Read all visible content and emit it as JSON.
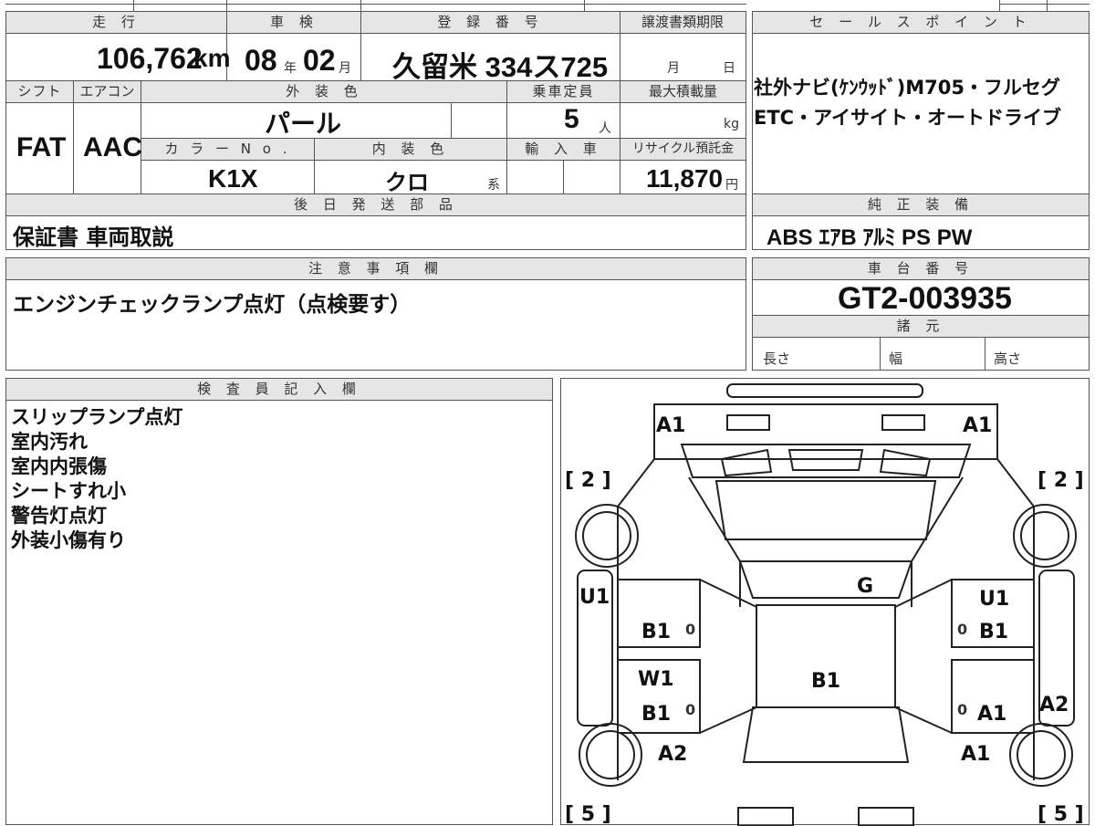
{
  "top_table": {
    "headers": {
      "mileage": "走 行",
      "inspection": "車 検",
      "registration": "登 録 番 号",
      "transfer_deadline": "譲渡書類期限",
      "shift": "シフト",
      "aircon": "エアコン",
      "exterior_color": "外 装 色",
      "capacity": "乗車定員",
      "max_load": "最大積載量",
      "color_no": "カ ラ ー N o .",
      "interior_color": "内 装 色",
      "import": "輸 入 車",
      "recycle_fee": "リサイクル預託金"
    },
    "mileage_value": "106,762",
    "mileage_unit": "km",
    "inspection_year": "08",
    "inspection_year_unit": "年",
    "inspection_month": "02",
    "inspection_month_unit": "月",
    "registration_value": "久留米 334ス725",
    "transfer_month_unit": "月",
    "transfer_day_unit": "日",
    "shift_value": "FAT",
    "aircon_value": "AAC",
    "exterior_color_value": "パール",
    "capacity_value": "5",
    "capacity_unit": "人",
    "max_load_unit": "kg",
    "color_no_value": "K1X",
    "interior_color_value": "クロ",
    "interior_color_suffix": "系",
    "recycle_fee_value": "11,870",
    "recycle_fee_unit": "円"
  },
  "sales_points": {
    "header": "セ ー ル ス ポ イ ン ト",
    "line1": "社外ナビ(ｹﾝｳｯﾄﾞ)M705・フルセグ",
    "line2": "ETC・アイサイト・オートドライブ"
  },
  "later_parts": {
    "header": "後 日 発 送 部 品",
    "value": "保証書 車両取説"
  },
  "genuine_equipment": {
    "header": "純 正 装 備",
    "value": "ABS ｴｱB ｱﾙﾐ PS PW"
  },
  "notes": {
    "header": "注 意 事 項 欄",
    "value": "エンジンチェックランプ点灯（点検要す）"
  },
  "chassis": {
    "header": "車 台 番 号",
    "value": "GT2-003935",
    "spec_header": "諸 元",
    "length": "長さ",
    "width": "幅",
    "height": "高さ"
  },
  "inspector": {
    "header": "検 査 員 記 入 欄",
    "lines": [
      "スリップランプ点灯",
      "室内汚れ",
      "室内内張傷",
      "シートすれ小",
      "警告灯点灯",
      "外装小傷有り"
    ]
  },
  "diagram": {
    "marks": {
      "front_left": "A1",
      "front_right": "A1",
      "bracket_tl": "[ 2 ]",
      "bracket_tr": "[ 2 ]",
      "bracket_bl": "[ 5 ]",
      "bracket_br": "[ 5 ]",
      "side_left": "U1",
      "side_right": "U1",
      "glass": "G",
      "front_door_left": "B1",
      "front_door_right": "B1",
      "rear_door_left_top": "W1",
      "rear_door_left": "B1",
      "rear_door_right": "A1",
      "roof": "B1",
      "rear_fender_left": "A2",
      "rear_fender_right": "A1",
      "rear_side_right": "A2",
      "handle_mark": "0"
    }
  }
}
